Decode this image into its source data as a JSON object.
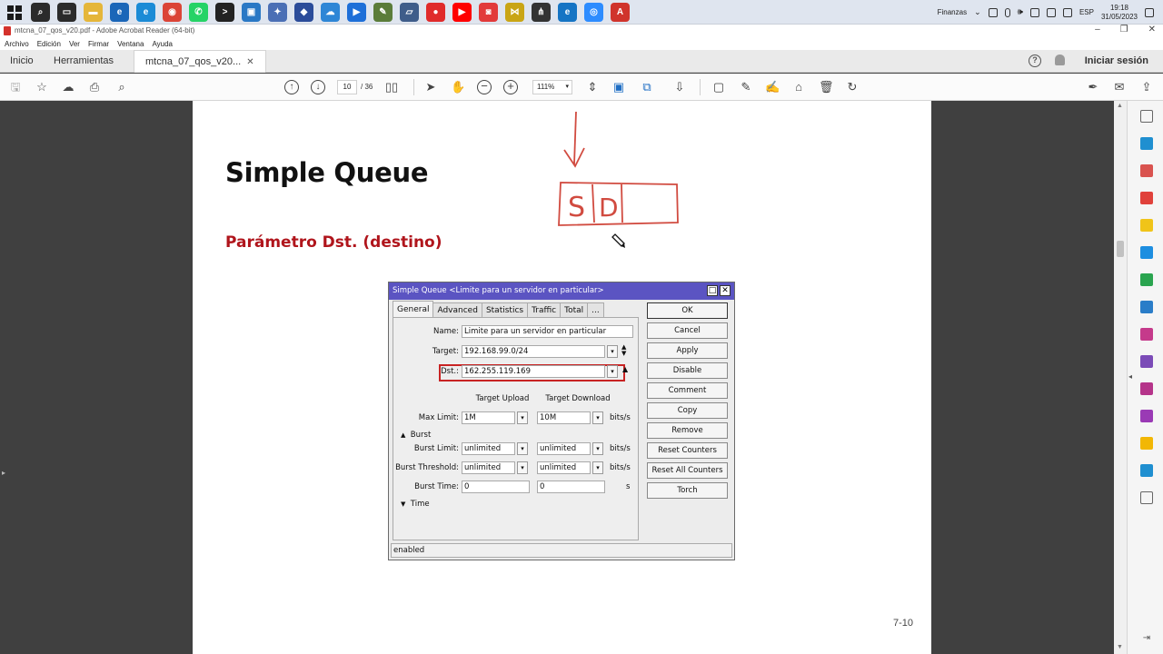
{
  "taskbar": {
    "apps": [
      {
        "name": "search",
        "glyph": "⌕",
        "color": "#2b2b2b"
      },
      {
        "name": "task-view",
        "glyph": "▭",
        "color": "#2b2b2b"
      },
      {
        "name": "file-explorer",
        "glyph": "▬",
        "color": "#e5b63a"
      },
      {
        "name": "edge-dev",
        "glyph": "e",
        "color": "#1a66b8"
      },
      {
        "name": "edge",
        "glyph": "e",
        "color": "#1b8bd6"
      },
      {
        "name": "chrome",
        "glyph": "◉",
        "color": "#db4437"
      },
      {
        "name": "whatsapp",
        "glyph": "✆",
        "color": "#25d366"
      },
      {
        "name": "terminal",
        "glyph": ">",
        "color": "#222222"
      },
      {
        "name": "remote-desktop",
        "glyph": "▣",
        "color": "#2a78c5"
      },
      {
        "name": "teams-like",
        "glyph": "✦",
        "color": "#4b6fb5"
      },
      {
        "name": "vpn-client",
        "glyph": "◆",
        "color": "#2b4c9a"
      },
      {
        "name": "cloud-app",
        "glyph": "☁",
        "color": "#2e86d6"
      },
      {
        "name": "media-player",
        "glyph": "▶",
        "color": "#1e6fd8"
      },
      {
        "name": "photos",
        "glyph": "✎",
        "color": "#5b7c3a"
      },
      {
        "name": "notes",
        "glyph": "▱",
        "color": "#3f5d8a"
      },
      {
        "name": "recorder",
        "glyph": "●",
        "color": "#e02b2b"
      },
      {
        "name": "youtube",
        "glyph": "▶",
        "color": "#ff0000"
      },
      {
        "name": "camera-app",
        "glyph": "◙",
        "color": "#e23a3a"
      },
      {
        "name": "network-tool",
        "glyph": "⋈",
        "color": "#c9a515"
      },
      {
        "name": "winbox",
        "glyph": "⋔",
        "color": "#333333"
      },
      {
        "name": "edge-beta",
        "glyph": "e",
        "color": "#1574c4"
      },
      {
        "name": "zoom",
        "glyph": "◎",
        "color": "#2d8cff"
      },
      {
        "name": "acrobat",
        "glyph": "A",
        "color": "#d0342c"
      }
    ],
    "tray_label": "Finanzas",
    "language": "ESP",
    "time": "19:18",
    "date": "31/05/2023"
  },
  "window": {
    "title": "mtcna_07_qos_v20.pdf - Adobe Acrobat Reader (64-bit)",
    "menu": [
      "Archivo",
      "Edición",
      "Ver",
      "Firmar",
      "Ventana",
      "Ayuda"
    ]
  },
  "tabs": {
    "home": "Inicio",
    "tools": "Herramientas",
    "document": "mtcna_07_qos_v20...",
    "signin": "Iniciar sesión"
  },
  "toolbar": {
    "current_page": "10",
    "total_pages": "/ 36",
    "zoom": "111%"
  },
  "page": {
    "title": "Simple Queue",
    "subtitle": "Parámetro Dst. (destino)",
    "page_number": "7-10",
    "ink_letters": [
      "S",
      "D"
    ]
  },
  "dialog": {
    "title": "Simple Queue <Limite para un servidor en particular>",
    "tabs": [
      "General",
      "Advanced",
      "Statistics",
      "Traffic",
      "Total",
      "..."
    ],
    "name_label": "Name:",
    "name_value": "Limite para un servidor en particular",
    "target_label": "Target:",
    "target_value": "192.168.99.0/24",
    "dst_label": "Dst.:",
    "dst_value": "162.255.119.169",
    "col_upload": "Target Upload",
    "col_download": "Target Download",
    "max_limit_label": "Max Limit:",
    "max_limit_up": "1M",
    "max_limit_down": "10M",
    "bits_unit": "bits/s",
    "burst_section": "Burst",
    "burst_limit_label": "Burst Limit:",
    "burst_limit_up": "unlimited",
    "burst_limit_down": "unlimited",
    "burst_threshold_label": "Burst Threshold:",
    "burst_threshold_up": "unlimited",
    "burst_threshold_down": "unlimited",
    "burst_time_label": "Burst Time:",
    "burst_time_up": "0",
    "burst_time_down": "0",
    "seconds_unit": "s",
    "time_section": "Time",
    "buttons": [
      "OK",
      "Cancel",
      "Apply",
      "Disable",
      "Comment",
      "Copy",
      "Remove",
      "Reset Counters",
      "Reset All Counters",
      "Torch"
    ],
    "status": "enabled"
  },
  "colors": {
    "accent_red": "#b0151c",
    "highlight_red": "#c82323",
    "dialog_title": "#5b54c2"
  }
}
